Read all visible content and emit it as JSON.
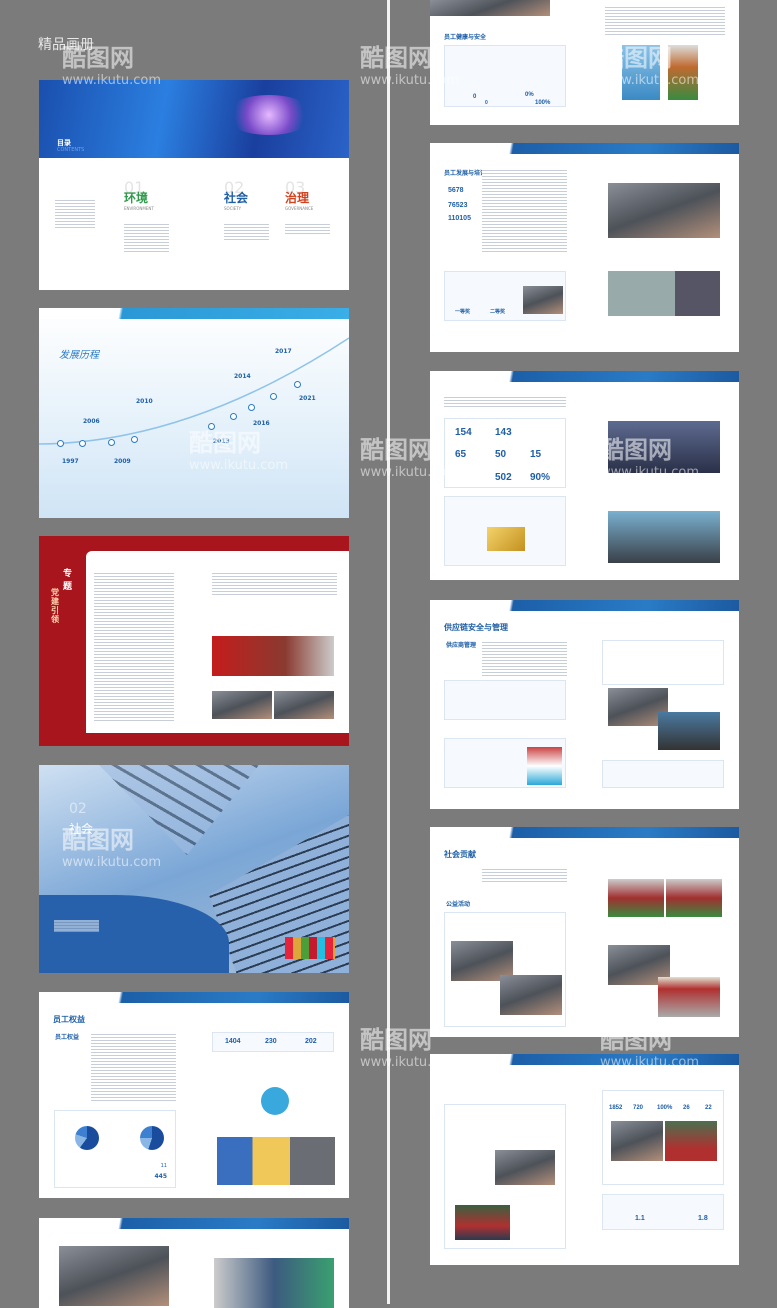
{
  "corner_label": "精品画册",
  "watermark": {
    "logo": "酷图网",
    "url": "www.ikutu.com"
  },
  "toc": {
    "title": "目录",
    "subtitle": "CONTENTS",
    "sections": [
      {
        "num": "01",
        "name": "环境",
        "en": "ENVIRONMENT",
        "color": "#2e9a4a"
      },
      {
        "num": "02",
        "name": "社会",
        "en": "SOCIETY",
        "color": "#1f5fa6"
      },
      {
        "num": "03",
        "name": "治理",
        "en": "GOVERNANCE",
        "color": "#d2421f"
      }
    ]
  },
  "timeline": {
    "title": "发展历程",
    "years": [
      "1997",
      "2006",
      "2009",
      "2010",
      "2013",
      "2014",
      "2016",
      "2017",
      "2021"
    ]
  },
  "party": {
    "title1": "专题",
    "title2": "党建引领"
  },
  "society_cover": {
    "num": "02",
    "title": "社会"
  },
  "employee_rights": {
    "title": "员工权益",
    "section": "员工权益",
    "stats": [
      "1404",
      "230",
      "202"
    ],
    "bars": [
      "11",
      "445"
    ]
  },
  "right_top": {
    "section": "员工健康与安全",
    "stats": [
      "0",
      "0",
      "0%",
      "100%"
    ]
  },
  "training": {
    "section": "员工发展与培训",
    "stats": [
      "5678",
      "76523",
      "110105"
    ],
    "awards": [
      "一等奖",
      "二等奖"
    ]
  },
  "safety_stats": {
    "stats": [
      "154",
      "143",
      "65",
      "50",
      "15",
      "502",
      "90%"
    ]
  },
  "supply": {
    "title": "供应链安全与管理",
    "section": "供应商管理"
  },
  "social": {
    "title": "社会贡献",
    "sections": [
      "公益活动"
    ]
  },
  "rural": {
    "stats": [
      "1852",
      "720",
      "100%",
      "26",
      "22"
    ],
    "bottom": [
      "1.1",
      "1.8"
    ]
  }
}
